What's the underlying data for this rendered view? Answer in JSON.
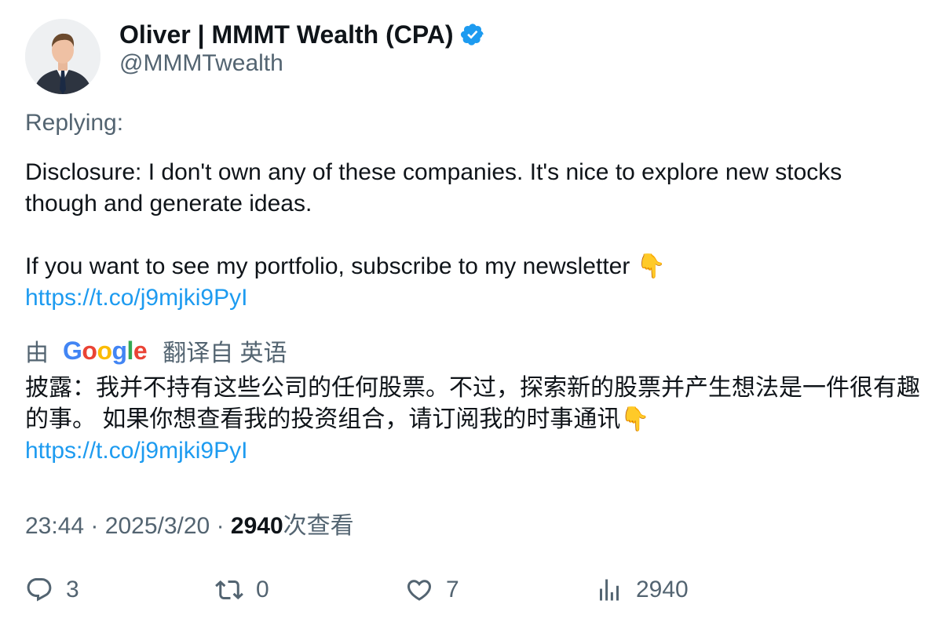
{
  "author": {
    "name": "Oliver | MMMT Wealth (CPA)",
    "handle": "@MMMTwealth",
    "verified": true
  },
  "reply_label": "Replying:",
  "tweet": {
    "line1": "Disclosure: I don't own any of these companies. It's nice to explore new stocks though and generate ideas.",
    "line2": "If you want to see my portfolio, subscribe to my newsletter",
    "emoji": "👇",
    "link": "https://t.co/j9mjki9PyI"
  },
  "translation": {
    "prefix": "由",
    "provider": "Google",
    "suffix": "翻译自 英语",
    "text": "披露：我并不持有这些公司的任何股票。不过，探索新的股票并产生想法是一件很有趣的事。 如果你想查看我的投资组合，请订阅我的时事通讯",
    "emoji": "👇",
    "link": "https://t.co/j9mjki9PyI"
  },
  "meta": {
    "time": "23:44",
    "separator": "·",
    "date": "2025/3/20",
    "views_count": "2940",
    "views_label": "次查看"
  },
  "actions": {
    "replies": "3",
    "retweets": "0",
    "likes": "7",
    "views": "2940"
  },
  "colors": {
    "link": "#1d9bf0",
    "secondary_text": "#536471",
    "primary_text": "#0f1419",
    "verified_badge": "#1d9bf0"
  },
  "icons": [
    "verified-badge-icon",
    "reply-icon",
    "retweet-icon",
    "like-icon",
    "views-icon"
  ]
}
